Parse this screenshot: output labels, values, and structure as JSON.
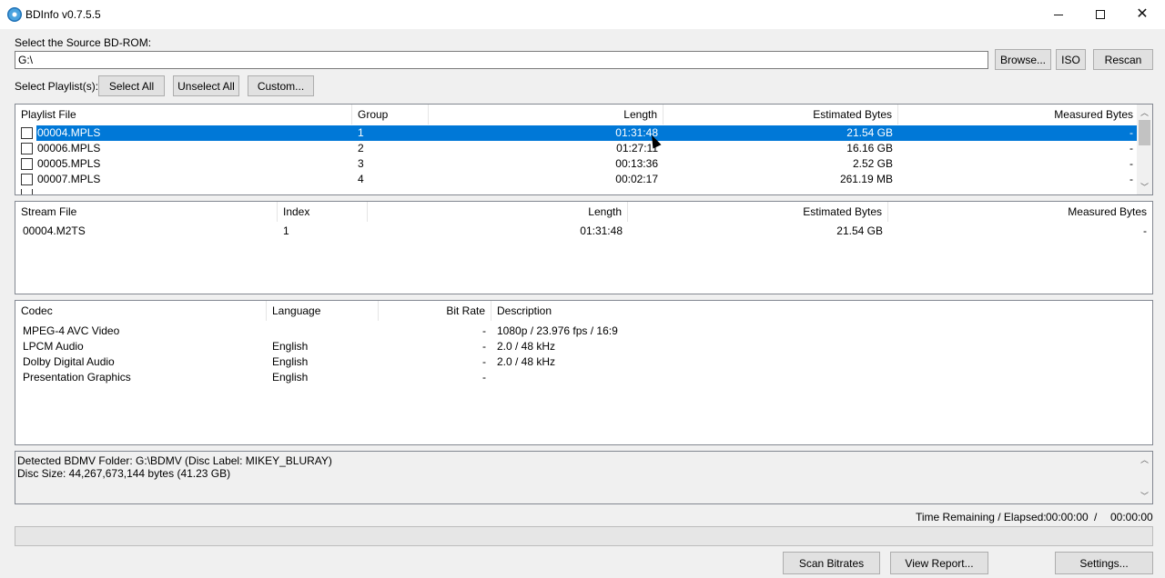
{
  "window": {
    "title": "BDInfo v0.7.5.5",
    "controls": {
      "minimize": "—",
      "maximize": "☐",
      "close": "✕"
    }
  },
  "source": {
    "label": "Select the Source BD-ROM:",
    "value": "G:\\",
    "browse": "Browse...",
    "iso": "ISO",
    "rescan": "Rescan"
  },
  "playlist_controls": {
    "label": "Select Playlist(s):",
    "select_all": "Select All",
    "unselect_all": "Unselect All",
    "custom": "Custom..."
  },
  "playlists": {
    "columns": [
      "Playlist File",
      "Group",
      "Length",
      "Estimated Bytes",
      "Measured Bytes"
    ],
    "rows": [
      {
        "file": "00004.MPLS",
        "group": "1",
        "length": "01:31:48",
        "estimated": "21.54 GB",
        "measured": "-",
        "selected": true,
        "checked": false
      },
      {
        "file": "00006.MPLS",
        "group": "2",
        "length": "01:27:11",
        "estimated": "16.16 GB",
        "measured": "-",
        "selected": false,
        "checked": false
      },
      {
        "file": "00005.MPLS",
        "group": "3",
        "length": "00:13:36",
        "estimated": "2.52 GB",
        "measured": "-",
        "selected": false,
        "checked": false
      },
      {
        "file": "00007.MPLS",
        "group": "4",
        "length": "00:02:17",
        "estimated": "261.19 MB",
        "measured": "-",
        "selected": false,
        "checked": false
      }
    ]
  },
  "streams": {
    "columns": [
      "Stream File",
      "Index",
      "Length",
      "Estimated Bytes",
      "Measured Bytes"
    ],
    "rows": [
      {
        "file": "00004.M2TS",
        "index": "1",
        "length": "01:31:48",
        "estimated": "21.54 GB",
        "measured": "-"
      }
    ]
  },
  "codecs": {
    "columns": [
      "Codec",
      "Language",
      "Bit Rate",
      "Description"
    ],
    "rows": [
      {
        "codec": "MPEG-4 AVC Video",
        "language": "",
        "bitrate": "-",
        "description": "1080p / 23.976 fps / 16:9"
      },
      {
        "codec": "LPCM Audio",
        "language": "English",
        "bitrate": "-",
        "description": "2.0 / 48 kHz"
      },
      {
        "codec": "Dolby Digital Audio",
        "language": "English",
        "bitrate": "-",
        "description": "2.0 / 48 kHz"
      },
      {
        "codec": "Presentation Graphics",
        "language": "English",
        "bitrate": "-",
        "description": ""
      }
    ]
  },
  "log": {
    "line1": "Detected BDMV Folder: G:\\BDMV (Disc Label: MIKEY_BLURAY)",
    "line2": "Disc Size: 44,267,673,144 bytes (41.23 GB)"
  },
  "status": {
    "label": "Time Remaining / Elapsed:",
    "remaining": "00:00:00",
    "separator": "/",
    "elapsed": "00:00:00",
    "progress": 0
  },
  "actions": {
    "scan_bitrates": "Scan Bitrates",
    "view_report": "View Report...",
    "settings": "Settings..."
  },
  "scroll_icons": {
    "up": "▲",
    "down": "▼",
    "up_chevron": "︿",
    "down_chevron": "﹀"
  }
}
